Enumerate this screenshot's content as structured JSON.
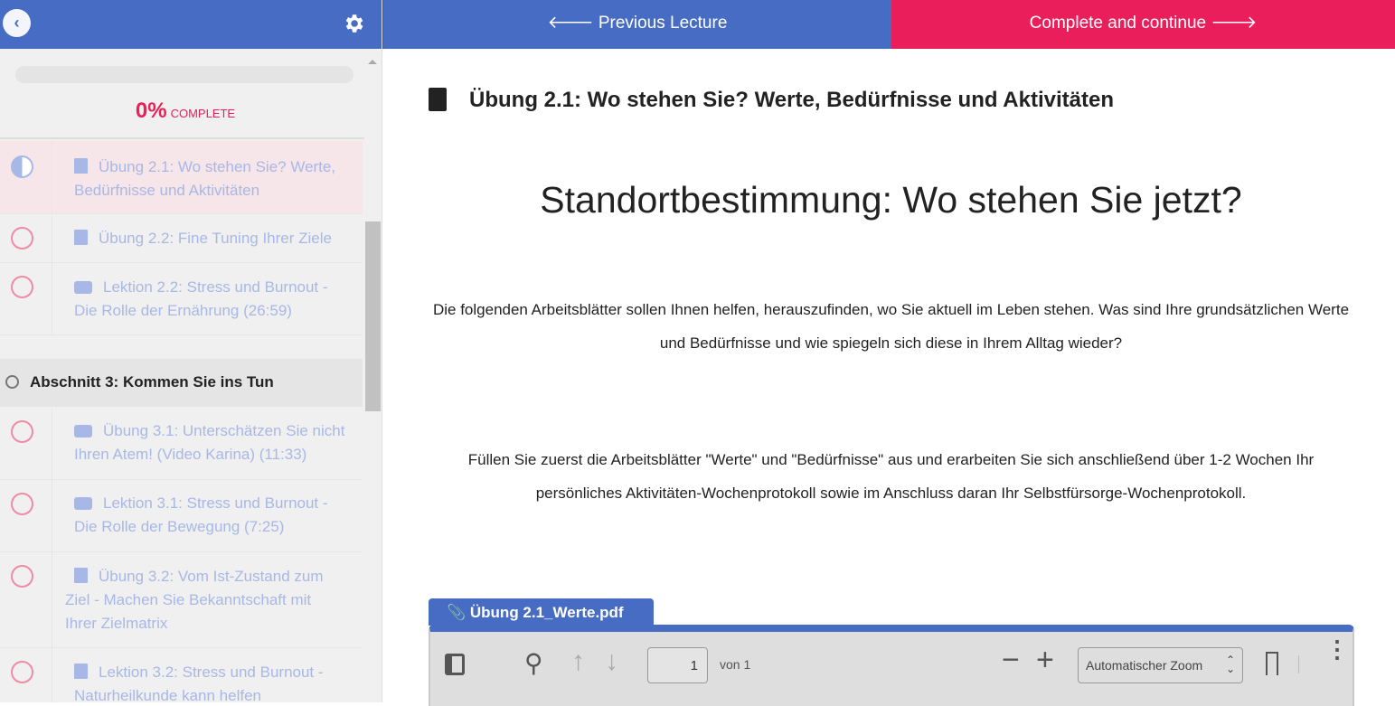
{
  "sidebar": {
    "progress_percent": "0%",
    "progress_label": "COMPLETE",
    "progress_value": 0,
    "items": [
      {
        "label": "Übung 2.1: Wo stehen Sie? Werte, Bedürfnisse und Aktivitäten",
        "status": "in-progress",
        "type": "document"
      },
      {
        "label": "Übung 2.2: Fine Tuning Ihrer Ziele",
        "status": "incomplete",
        "type": "document"
      },
      {
        "label": "Lektion 2.2: Stress und Burnout - Die Rolle der Ernährung (26:59)",
        "status": "incomplete",
        "type": "video"
      },
      {
        "label": "Übung 3.1: Unterschätzen Sie nicht Ihren Atem! (Video Karina) (11:33)",
        "status": "incomplete",
        "type": "video"
      },
      {
        "label": "Lektion 3.1: Stress und Burnout - Die Rolle der Bewegung (7:25)",
        "status": "incomplete",
        "type": "video"
      },
      {
        "label": "Übung 3.2: Vom Ist-Zustand zum Ziel - Machen Sie Bekanntschaft mit Ihrer Zielmatrix",
        "status": "incomplete",
        "type": "document"
      },
      {
        "label": "Lektion 3.2: Stress und Burnout - Naturheilkunde kann helfen",
        "status": "incomplete",
        "type": "document"
      }
    ],
    "section": "Abschnitt 3: Kommen Sie ins Tun"
  },
  "nav": {
    "prev": "🡐 Previous Lecture",
    "next": "Complete and continue 🡒"
  },
  "main": {
    "title": "Übung 2.1: Wo stehen Sie? Werte, Bedürfnisse und Aktivitäten",
    "heading": "Standortbestimmung: Wo stehen Sie jetzt?",
    "para1": "Die folgenden Arbeitsblätter sollen Ihnen helfen, herauszufinden, wo Sie aktuell im Leben stehen. Was sind Ihre grundsätzlichen Werte und Bedürfnisse und wie spiegeln sich diese in Ihrem Alltag wieder?",
    "para2": "Füllen Sie zuerst die Arbeitsblätter \"Werte\" und \"Bedürfnisse\" aus und erarbeiten Sie sich anschließend über 1-2 Wochen Ihr persönliches Aktivitäten-Wochenprotokoll sowie im Anschluss daran Ihr Selbstfürsorge-Wochenprotokoll.",
    "attachment": "Übung 2.1_Werte.pdf",
    "pdf": {
      "page": "1",
      "of": "von 1",
      "zoom": "Automatischer Zoom"
    }
  },
  "colors": {
    "blue": "#476cc4",
    "pink": "#e91e5a"
  }
}
